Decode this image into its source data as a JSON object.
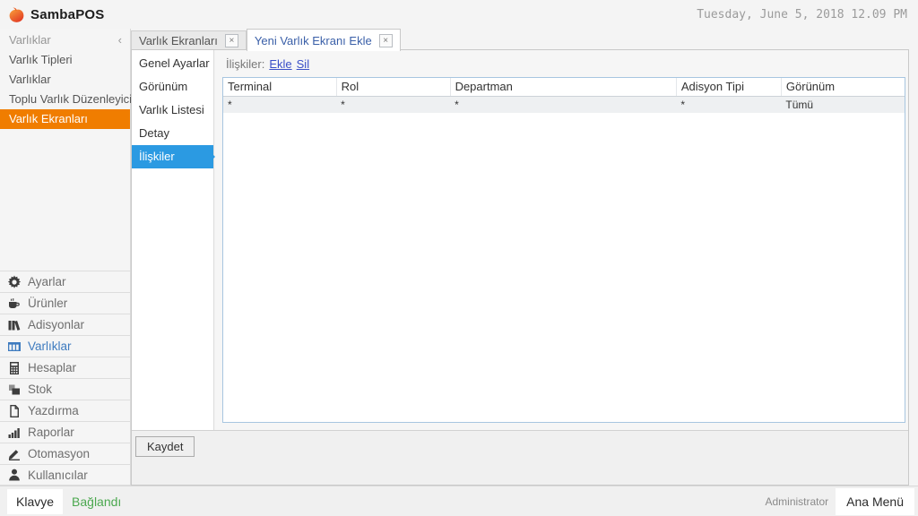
{
  "app": {
    "brand": "SambaPOS",
    "datetime": "Tuesday, June 5, 2018 12.09 PM"
  },
  "ui": {
    "close_glyph": "×",
    "collapse_glyph": "‹"
  },
  "colors": {
    "accent_orange": "#f07d00",
    "accent_blue": "#2b9ae2",
    "link_blue": "#3a4fc8",
    "connected_green": "#4ba84f"
  },
  "sidebar": {
    "header": "Varlıklar",
    "items": [
      {
        "label": "Varlık Tipleri",
        "selected": false
      },
      {
        "label": "Varlıklar",
        "selected": false
      },
      {
        "label": "Toplu Varlık Düzenleyici",
        "selected": false
      },
      {
        "label": "Varlık Ekranları",
        "selected": true
      }
    ],
    "menu": [
      {
        "label": "Ayarlar",
        "icon": "gear-icon"
      },
      {
        "label": "Ürünler",
        "icon": "coffee-icon"
      },
      {
        "label": "Adisyonlar",
        "icon": "books-icon"
      },
      {
        "label": "Varlıklar",
        "icon": "table-icon",
        "selected": true
      },
      {
        "label": "Hesaplar",
        "icon": "calculator-icon"
      },
      {
        "label": "Stok",
        "icon": "boxes-icon"
      },
      {
        "label": "Yazdırma",
        "icon": "document-icon"
      },
      {
        "label": "Raporlar",
        "icon": "bar-chart-icon"
      },
      {
        "label": "Otomasyon",
        "icon": "pencil-icon"
      },
      {
        "label": "Kullanıcılar",
        "icon": "user-icon"
      }
    ]
  },
  "tabs": [
    {
      "label": "Varlık Ekranları",
      "active": false
    },
    {
      "label": "Yeni Varlık Ekranı Ekle",
      "active": true
    }
  ],
  "editor_nav": {
    "items": [
      "Genel Ayarlar",
      "Görünüm",
      "Varlık Listesi",
      "Detay",
      "İlişkiler"
    ],
    "selected": "İlişkiler"
  },
  "relations": {
    "label": "İlişkiler:",
    "add_link": "Ekle",
    "delete_link": "Sil",
    "table": {
      "columns": [
        "Terminal",
        "Rol",
        "Departman",
        "Adisyon Tipi",
        "Görünüm"
      ],
      "rows": [
        [
          "*",
          "*",
          "*",
          "*",
          "Tümü"
        ]
      ]
    }
  },
  "footer": {
    "save_button": "Kaydet"
  },
  "statusbar": {
    "keyboard_button": "Klavye",
    "connection_status": "Bağlandı",
    "user": "Administrator",
    "main_menu_button": "Ana Menü"
  }
}
